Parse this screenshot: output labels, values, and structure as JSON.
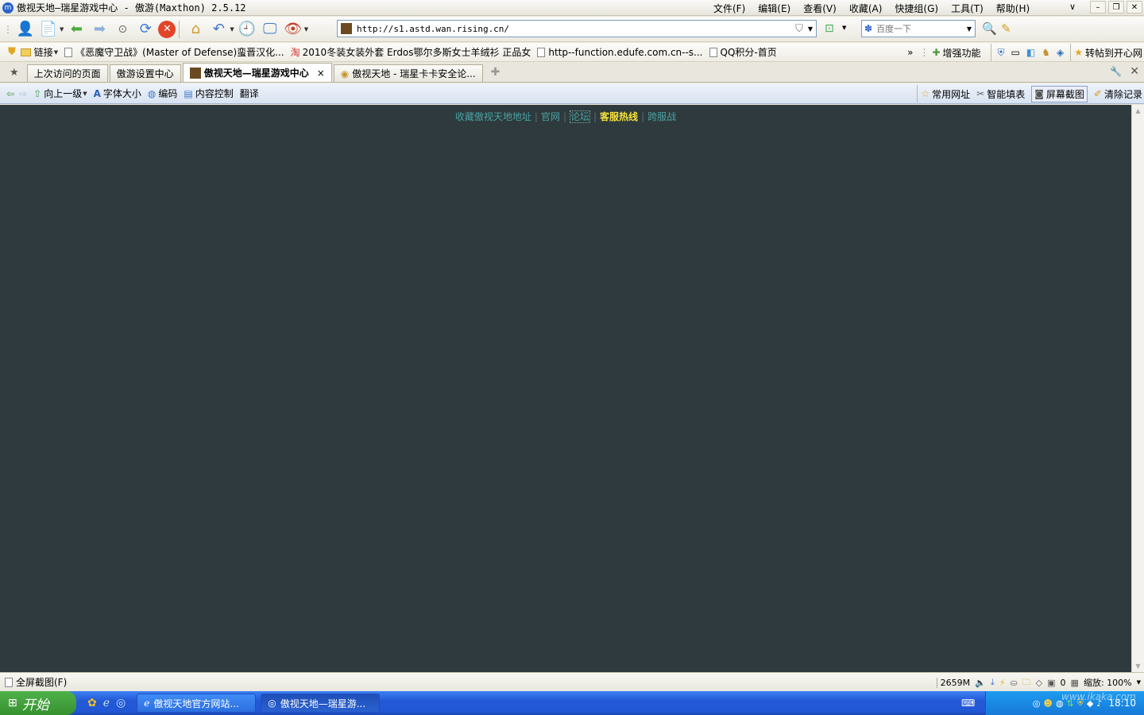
{
  "window": {
    "title": "傲视天地—瑞星游戏中心 - 傲游(Maxthon) 2.5.12",
    "menu": [
      "文件(F)",
      "编辑(E)",
      "查看(V)",
      "收藏(A)",
      "快捷组(G)",
      "工具(T)",
      "帮助(H)"
    ]
  },
  "toolbar": {
    "address": "http://s1.astd.wan.rising.cn/",
    "search_placeholder": "百度一下"
  },
  "bookmarks": {
    "links_label": "链接",
    "items": [
      "《恶魔守卫战》(Master of Defense)蛮晋汉化...",
      "2010冬装女装外套 Erdos鄂尔多斯女士羊绒衫 正品女",
      "http--function.edufe.com.cn--s...",
      "QQ积分-首页"
    ],
    "more": "»",
    "enhance": "增强功能",
    "repost": "转帖到开心网"
  },
  "tabs": [
    {
      "label": "上次访问的页面",
      "active": false
    },
    {
      "label": "傲游设置中心",
      "active": false
    },
    {
      "label": "傲视天地—瑞星游戏中心",
      "active": true
    },
    {
      "label": "傲视天地 - 瑞星卡卡安全论...",
      "active": false
    }
  ],
  "navbar": {
    "up": "向上一级",
    "font_size": "字体大小",
    "encoding": "编码",
    "content_control": "内容控制",
    "translate": "翻译",
    "favorites": "常用网址",
    "autofill": "智能填表",
    "screenshot": "屏幕截图",
    "clear": "清除记录"
  },
  "page": {
    "links": [
      "收藏傲视天地地址",
      "官网",
      "论坛",
      "客服热线",
      "跨服战"
    ],
    "bg_color": "#2e3a3d",
    "hot_color": "#f5e23c"
  },
  "status": {
    "left": "全屏截图(F)",
    "memory": "2659M",
    "counter": "0",
    "zoom": "缩放: 100%"
  },
  "taskbar": {
    "start": "开始",
    "tasks": [
      "傲视天地官方网站...",
      "傲视天地—瑞星游..."
    ],
    "clock": "18:10",
    "watermark": "www.ikaka.com"
  }
}
